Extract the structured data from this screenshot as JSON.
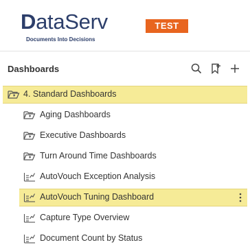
{
  "app": {
    "logo_word": "ataServ",
    "logo_letter": "D",
    "tagline": "Documents Into Decisions",
    "env_badge": "TEST"
  },
  "panel": {
    "title": "Dashboards",
    "tools": [
      "search-icon",
      "bookmark-add-icon",
      "plus-icon"
    ]
  },
  "tree": {
    "folder": {
      "label": "4. Standard Dashboards",
      "icon": "folder-open-icon",
      "selected": true
    },
    "items": [
      {
        "label": "Aging Dashboards",
        "icon": "subfolder-icon"
      },
      {
        "label": "Executive Dashboards",
        "icon": "subfolder-icon"
      },
      {
        "label": "Turn Around Time Dashboards",
        "icon": "subfolder-icon"
      },
      {
        "label": "AutoVouch Exception Analysis",
        "icon": "dashboard-icon"
      },
      {
        "label": "AutoVouch Tuning Dashboard",
        "icon": "dashboard-icon",
        "selected": true
      },
      {
        "label": "Capture Type Overview",
        "icon": "dashboard-icon"
      },
      {
        "label": "Document Count by Status",
        "icon": "dashboard-icon"
      }
    ]
  },
  "colors": {
    "brand": "#2c3e6a",
    "badge": "#e8651f",
    "highlight": "#f6eb97"
  }
}
